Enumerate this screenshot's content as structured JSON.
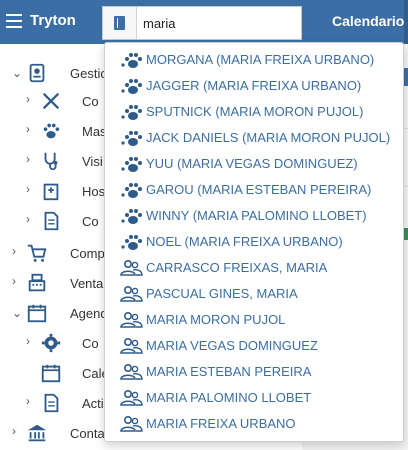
{
  "app": {
    "title": "Tryton"
  },
  "header": {
    "calendar_label": "Calendario"
  },
  "search": {
    "value": "maria",
    "placeholder": ""
  },
  "sidebar": {
    "items": [
      {
        "label": "Gestio",
        "icon": "vet-icon",
        "expanded": true
      },
      {
        "label": "Co",
        "icon": "tools-icon"
      },
      {
        "label": "Mas",
        "icon": "paw-icon"
      },
      {
        "label": "Visi",
        "icon": "stethoscope-icon"
      },
      {
        "label": "Hos",
        "icon": "hospital-icon"
      },
      {
        "label": "Co",
        "icon": "document-icon"
      },
      {
        "label": "Comp",
        "icon": "cart-icon"
      },
      {
        "label": "Venta",
        "icon": "register-icon"
      },
      {
        "label": "Agend",
        "icon": "calendar-icon",
        "expanded": true
      },
      {
        "label": "Co",
        "icon": "gear-icon"
      },
      {
        "label": "Cale",
        "icon": "calendar-icon"
      },
      {
        "label": "Acti",
        "icon": "document-icon"
      },
      {
        "label": "Conta",
        "icon": "bank-icon"
      }
    ]
  },
  "results": [
    {
      "label": "MORGANA (MARIA FREIXA URBANO)",
      "icon": "paw-icon"
    },
    {
      "label": "JAGGER (MARIA FREIXA URBANO)",
      "icon": "paw-icon"
    },
    {
      "label": "SPUTNICK (MARIA MORON PUJOL)",
      "icon": "paw-icon"
    },
    {
      "label": "JACK DANIELS (MARIA MORON PUJOL)",
      "icon": "paw-icon"
    },
    {
      "label": "YUU (MARIA VEGAS DOMINGUEZ)",
      "icon": "paw-icon"
    },
    {
      "label": "GAROU (MARIA ESTEBAN PEREIRA)",
      "icon": "paw-icon"
    },
    {
      "label": "WINNY (MARIA PALOMINO LLOBET)",
      "icon": "paw-icon"
    },
    {
      "label": "NOEL (MARIA FREIXA URBANO)",
      "icon": "paw-icon"
    },
    {
      "label": "CARRASCO FREIXAS, MARIA",
      "icon": "people-icon"
    },
    {
      "label": "PASCUAL GINES, MARIA",
      "icon": "people-icon"
    },
    {
      "label": "MARIA MORON PUJOL",
      "icon": "people-icon"
    },
    {
      "label": "MARIA VEGAS DOMINGUEZ",
      "icon": "people-icon"
    },
    {
      "label": "MARIA ESTEBAN PEREIRA",
      "icon": "people-icon"
    },
    {
      "label": "MARIA PALOMINO LLOBET",
      "icon": "people-icon"
    },
    {
      "label": "MARIA FREIXA URBANO",
      "icon": "people-icon"
    }
  ],
  "colors": {
    "header": "#3b6ea5",
    "link": "#3b6ea5",
    "icon": "#2f5b8a"
  }
}
